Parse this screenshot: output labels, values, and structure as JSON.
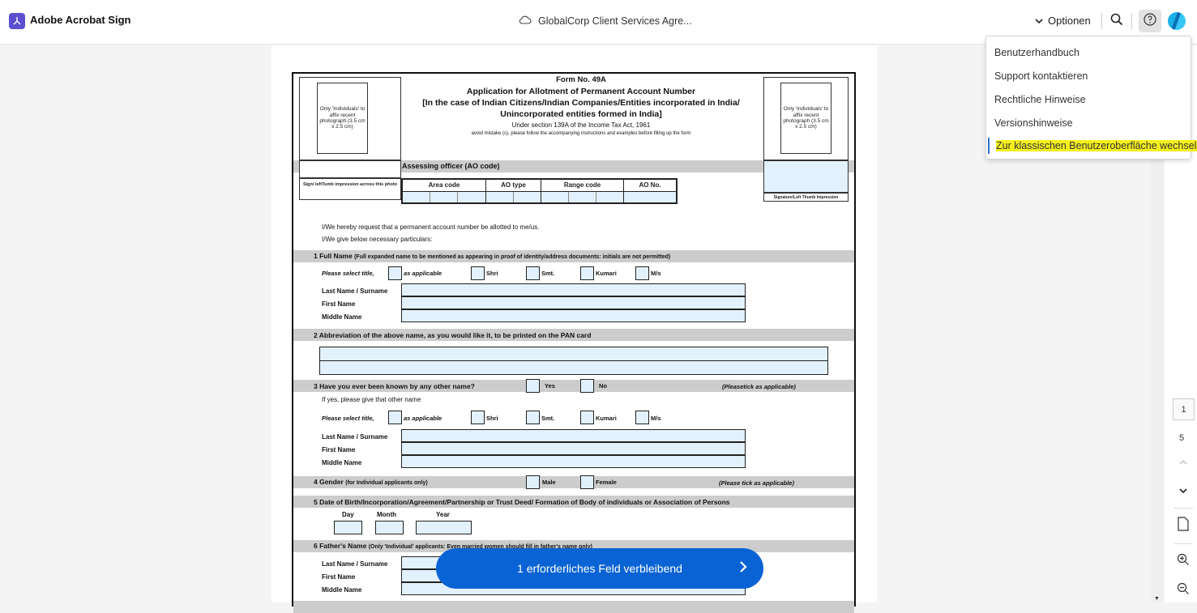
{
  "app": {
    "name": "Adobe Acrobat Sign",
    "brand_color": "#5a4fcf"
  },
  "header": {
    "document_title": "GlobalCorp Client Services Agre...",
    "options_label": "Optionen"
  },
  "help_menu": {
    "items": [
      {
        "label": "Benutzerhandbuch"
      },
      {
        "label": "Support kontaktieren"
      },
      {
        "label": "Rechtliche Hinweise"
      },
      {
        "label": "Versionshinweise"
      },
      {
        "label": "Zur klassischen Benutzeroberfläche wechseln",
        "highlighted": true
      }
    ],
    "highlight_color": "#f5ef1c"
  },
  "page_nav": {
    "current_page": "1",
    "total_pages": "5"
  },
  "cta": {
    "label": "1 erforderliches Feld verbleibend",
    "color": "#0a63d4"
  },
  "form": {
    "photo_left": "Only 'Individuals' to affix recent photograph (3.5 cm x 2.5 cm)",
    "photo_right": "Only 'Individuals' to affix recent photograph (3.5 cm x 2.5 cm)",
    "sign_left": "Sign/ leftTumb impression across this photo",
    "sign_right": "Signature/Left Thumb Impression",
    "form_no": "Form No. 49A",
    "title": "Application for Allotment of Permanent Account Number",
    "subtitle1": "[In the  case of Indian Citizens/Indian Companies/Entities incorporated in India/",
    "subtitle2": "Unincorporated entities formed in India]",
    "section_ref": "Under section 139A of the Income Tax Act, 1961",
    "instruction": "avoid mistake (s), please follow the accompanying instructions and examples before filling up the form",
    "ao_heading": "Assessing officer  (AO code)",
    "ao_columns": [
      "Area code",
      "AO type",
      "Range code",
      "AO No."
    ],
    "request_line1": "I/We hereby request that a permanent account number be allotted to me/us.",
    "request_line2": "I/We give below necessary particulars:",
    "s1_title": "1 Full Name",
    "s1_sub": "(Full expanded name to be mentioned as appearing in proof of identity/address documents: initials are not permitted)",
    "title_prompt": "Please select title,",
    "title_options": [
      "as applicable",
      "Shri",
      "Smt.",
      "Kumari",
      "M/s"
    ],
    "name_labels": [
      "Last Name / Surname",
      "First Name",
      "Middle Name"
    ],
    "s2_title": "2 Abbreviation of the above name, as you would like it, to be printed on the PAN card",
    "s3_title": "3 Have you ever been known by any other name?",
    "yes": "Yes",
    "no": "No",
    "tick_note": "(Pleasetick as applicable)",
    "other_name_prompt": "If yes, please give that other name",
    "s4_title": "4 Gender",
    "s4_sub": "(for Individual applicants only)",
    "male": "Male",
    "female": "Female",
    "tick_note2": "(Please tick as applicable)",
    "s5_title": "5 Date of Birth/Incorporation/Agreement/Partnership or Trust Deed/ Formation of Body of individuals or Association of Persons",
    "date_labels": [
      "Day",
      "Month",
      "Year"
    ],
    "s6_title": "6 Father's Name",
    "s6_sub": "(Only 'Individual' applicants: Even married women should fill in father's name only)"
  }
}
